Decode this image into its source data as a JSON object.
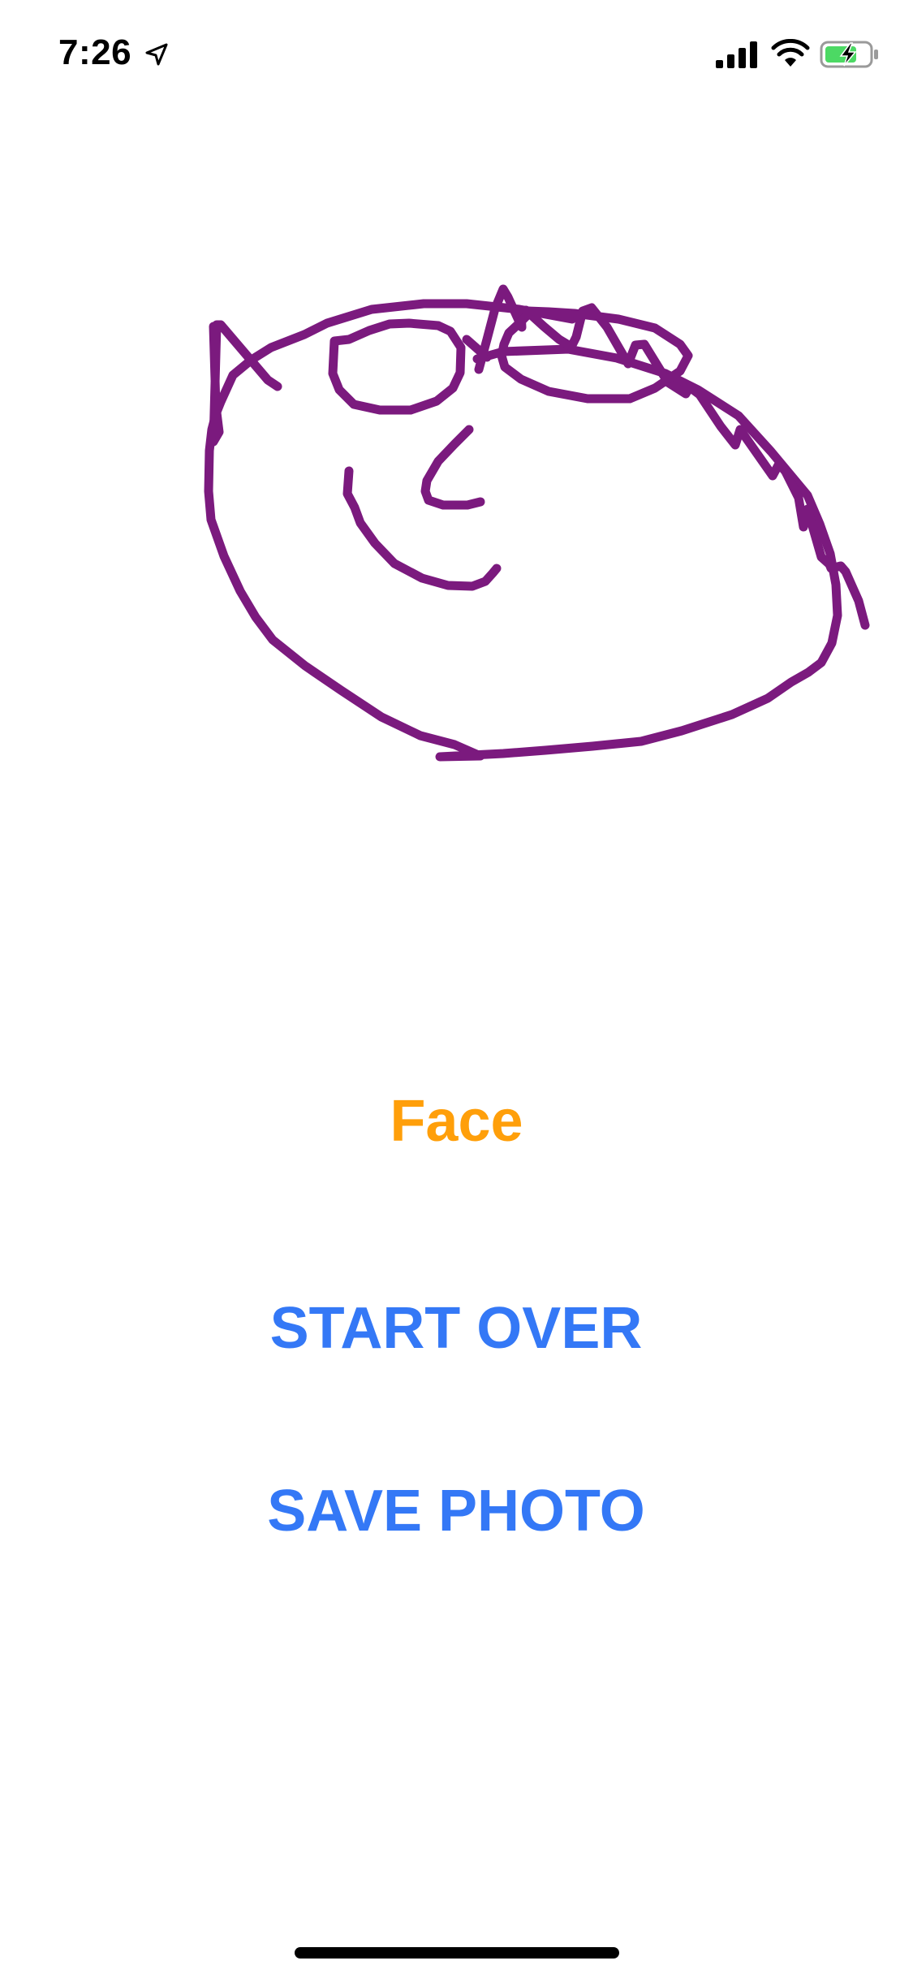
{
  "status_bar": {
    "time": "7:26",
    "icons": [
      "location-arrow-icon",
      "cellular-signal-icon",
      "wifi-icon",
      "battery-charging-icon"
    ]
  },
  "drawing": {
    "stroke_color": "#7B1A7E"
  },
  "prediction": {
    "label": "Face",
    "color": "#FF9F0A"
  },
  "buttons": {
    "start_over_label": "START OVER",
    "save_photo_label": "SAVE PHOTO",
    "color": "#3478F6"
  }
}
